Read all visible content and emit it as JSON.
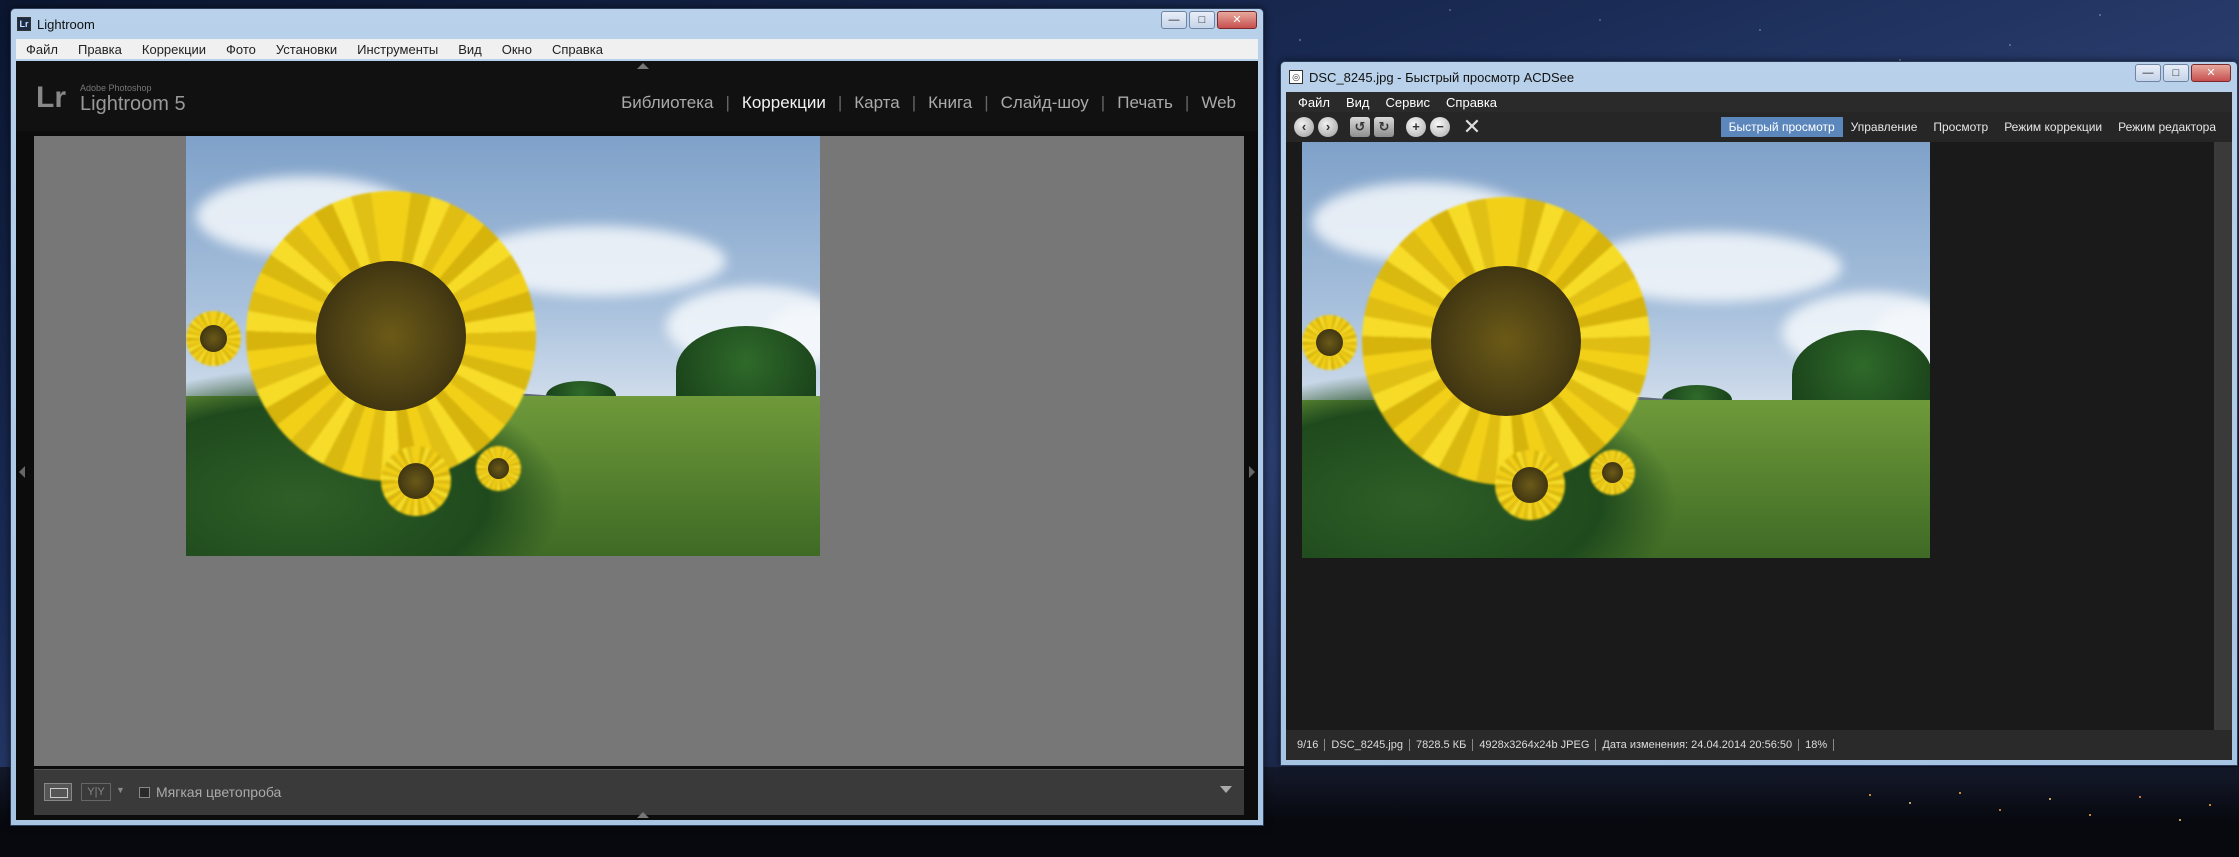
{
  "lightroom": {
    "window_title": "Lightroom",
    "menu": [
      "Файл",
      "Правка",
      "Коррекции",
      "Фото",
      "Установки",
      "Инструменты",
      "Вид",
      "Окно",
      "Справка"
    ],
    "logo": "Lr",
    "brand_small": "Adobe Photoshop",
    "brand": "Lightroom 5",
    "modules": [
      "Библиотека",
      "Коррекции",
      "Карта",
      "Книга",
      "Слайд-шоу",
      "Печать",
      "Web"
    ],
    "active_module": "Коррекции",
    "toolbar": {
      "yy_label": "Y|Y",
      "soft_proof_label": "Мягкая цветопроба",
      "soft_proof_checked": false
    }
  },
  "acdsee": {
    "window_title": "DSC_8245.jpg - Быстрый просмотр ACDSee",
    "menu": [
      "Файл",
      "Вид",
      "Сервис",
      "Справка"
    ],
    "modes": [
      "Быстрый просмотр",
      "Управление",
      "Просмотр",
      "Режим коррекции",
      "Режим редактора"
    ],
    "active_mode": "Быстрый просмотр",
    "status": {
      "position": "9/16",
      "filename": "DSC_8245.jpg",
      "filesize": "7828.5 КБ",
      "dims": "4928x3264x24b JPEG",
      "modified": "Дата изменения: 24.04.2014 20:56:50",
      "zoom": "18%"
    }
  },
  "window_controls": {
    "minimize": "—",
    "maximize": "□",
    "close": "✕"
  },
  "colors": {
    "acd_active_mode": "#5b87bd",
    "sunflower": "#f2d018"
  }
}
